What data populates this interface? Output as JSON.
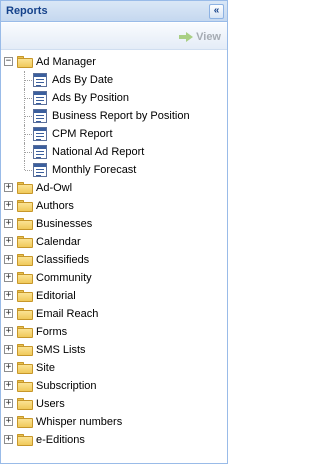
{
  "panel": {
    "title": "Reports",
    "collapse_icon": "«",
    "view_label": "View"
  },
  "tree": {
    "expanded": {
      "label": "Ad Manager",
      "toggle": "−",
      "children": [
        "Ads By Date",
        "Ads By Position",
        "Business Report by Position",
        "CPM Report",
        "National Ad Report",
        "Monthly Forecast"
      ]
    },
    "folders": [
      "Ad-Owl",
      "Authors",
      "Businesses",
      "Calendar",
      "Classifieds",
      "Community",
      "Editorial",
      "Email Reach",
      "Forms",
      "SMS Lists",
      "Site",
      "Subscription",
      "Users",
      "Whisper numbers",
      "e-Editions"
    ],
    "collapsed_toggle": "+"
  },
  "colors": {
    "header_text": "#15428b",
    "border": "#99bbe8",
    "view_disabled": "#a6acb3"
  }
}
